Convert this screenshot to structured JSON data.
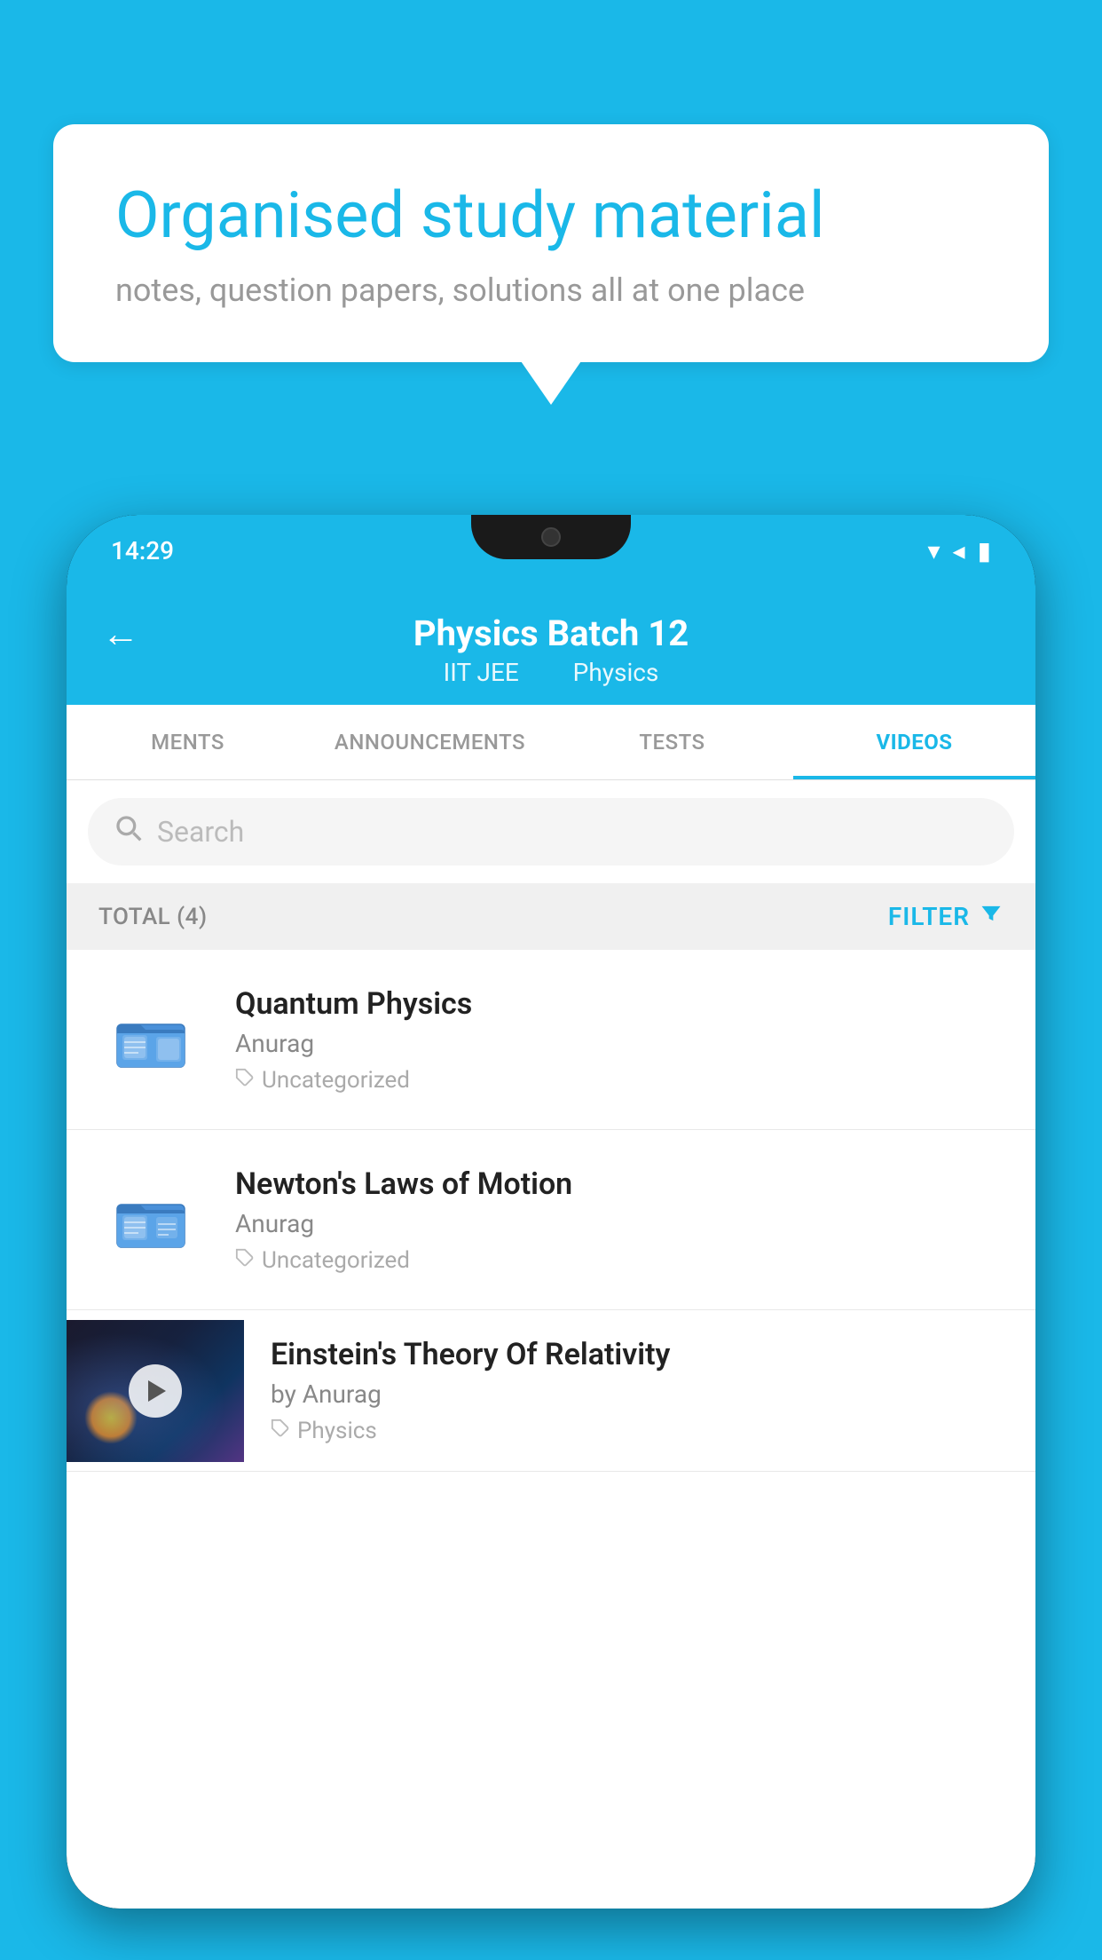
{
  "background": {
    "color": "#1ab8e8"
  },
  "speech_bubble": {
    "title": "Organised study material",
    "subtitle": "notes, question papers, solutions all at one place"
  },
  "phone": {
    "status_bar": {
      "time": "14:29"
    },
    "header": {
      "back_label": "←",
      "title": "Physics Batch 12",
      "subtitle_part1": "IIT JEE",
      "subtitle_part2": "Physics"
    },
    "tabs": [
      {
        "label": "MENTS",
        "active": false
      },
      {
        "label": "ANNOUNCEMENTS",
        "active": false
      },
      {
        "label": "TESTS",
        "active": false
      },
      {
        "label": "VIDEOS",
        "active": true
      }
    ],
    "search": {
      "placeholder": "Search"
    },
    "filter": {
      "total_label": "TOTAL (4)",
      "filter_label": "FILTER"
    },
    "videos": [
      {
        "id": 1,
        "title": "Quantum Physics",
        "author": "Anurag",
        "tag": "Uncategorized",
        "has_thumbnail": false
      },
      {
        "id": 2,
        "title": "Newton's Laws of Motion",
        "author": "Anurag",
        "tag": "Uncategorized",
        "has_thumbnail": false
      },
      {
        "id": 3,
        "title": "Einstein's Theory Of Relativity",
        "author": "by Anurag",
        "tag": "Physics",
        "has_thumbnail": true
      }
    ]
  }
}
